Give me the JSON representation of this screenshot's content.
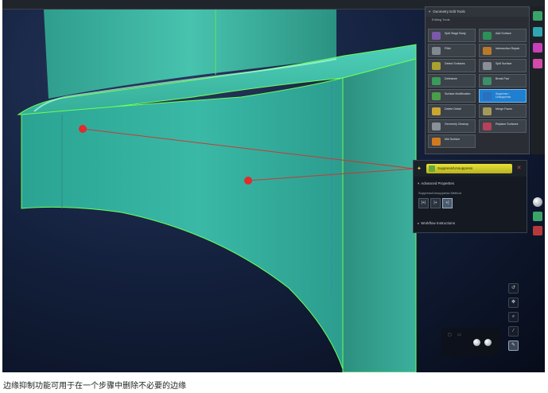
{
  "geometry_panel": {
    "title": "Geometry Edit Tools",
    "subtitle": "Editing Tools",
    "tools": [
      {
        "label": "Split Stage Body",
        "icon": "split-body-icon",
        "active": false
      },
      {
        "label": "Add Surface",
        "icon": "add-surface-icon",
        "active": false
      },
      {
        "label": "Fillet",
        "icon": "fillet-icon",
        "active": false
      },
      {
        "label": "Intersection Repair",
        "icon": "intersection-repair-icon",
        "active": false
      },
      {
        "label": "Detect Surfaces",
        "icon": "detect-surfaces-icon",
        "active": false
      },
      {
        "label": "Split Surface",
        "icon": "split-surface-icon",
        "active": false
      },
      {
        "label": "Defeature",
        "icon": "defeature-icon",
        "active": false
      },
      {
        "label": "Break Pad",
        "icon": "break-pad-icon",
        "active": false
      },
      {
        "label": "Surface Modification",
        "icon": "surface-modification-icon",
        "active": false
      },
      {
        "label": "Suppress / Unsuppress",
        "icon": "suppress-unsuppress-icon",
        "active": true
      },
      {
        "label": "Delete Detail",
        "icon": "delete-detail-icon",
        "active": false
      },
      {
        "label": "Merge Faces",
        "icon": "merge-faces-icon",
        "active": false
      },
      {
        "label": "Geometry Cleanup",
        "icon": "geometry-cleanup-icon",
        "active": false
      },
      {
        "label": "Replace Surfaces",
        "icon": "replace-surfaces-icon",
        "active": false
      },
      {
        "label": "Mid Surface",
        "icon": "mid-surface-icon",
        "active": false
      }
    ]
  },
  "property_panel": {
    "title": "Suppress/Unsuppress",
    "advanced_label": "Advanced Properties",
    "method_label": "Suppress/Unsuppress Method",
    "modes": [
      {
        "label": "|+|",
        "icon": "suppress-mode-icon",
        "active": false
      },
      {
        "label": "|+",
        "icon": "unsuppress-mode-icon",
        "active": false
      },
      {
        "label": "+|",
        "icon": "toggle-mode-icon",
        "active": true
      }
    ],
    "instructions_label": "Workflow Instructions"
  },
  "colors": {
    "part_face": "#36b3a0",
    "part_edge": "#6dff5a",
    "callout": "#c83a36",
    "active_tool": "#1f7fd0",
    "title_bar": "#e0da33"
  },
  "caption": "边缘抑制功能可用于在一个步骤中删除不必要的边缘"
}
